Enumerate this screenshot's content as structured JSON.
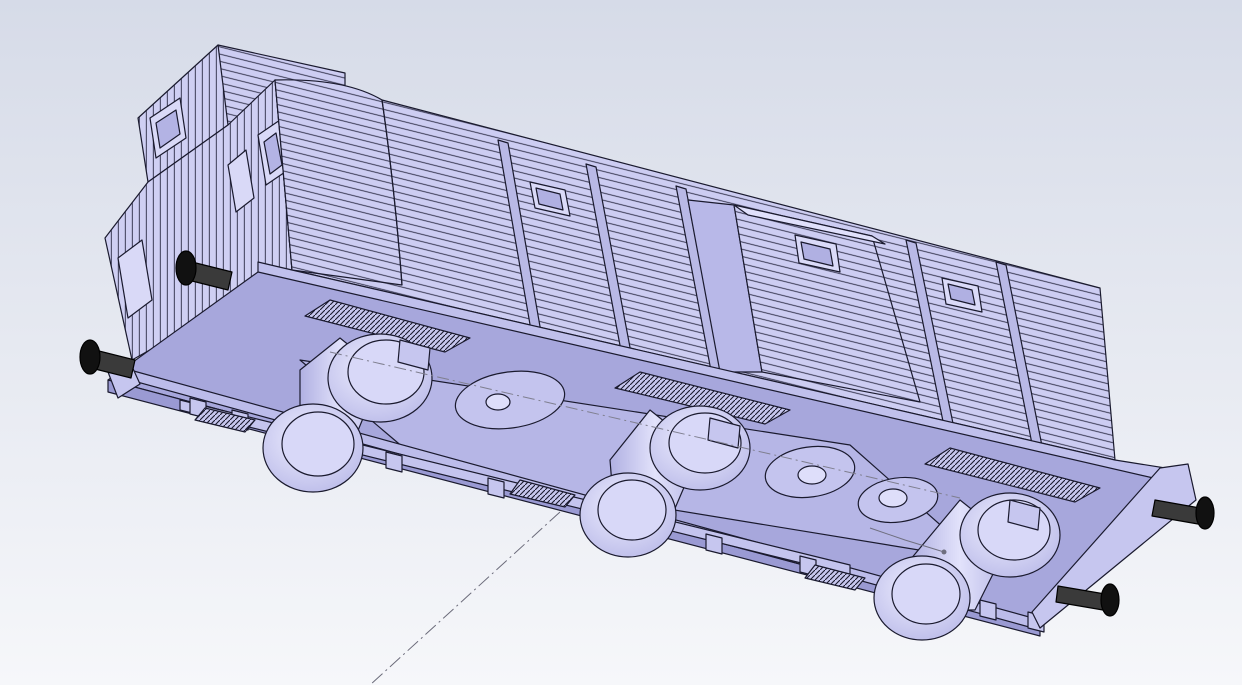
{
  "viewport": {
    "background_top": "#d6dbe8",
    "background_bottom": "#f6f7fa"
  },
  "model": {
    "body_fill": "#c9c9f0",
    "body_light": "#dcdcf8",
    "body_dark": "#a9a9de",
    "underframe_fill": "#aaaade",
    "underframe_dark": "#8f8fcb",
    "edge_color": "#1a1a2e",
    "buffer_color": "#111111",
    "centerline_color": "#7f7f8f"
  }
}
